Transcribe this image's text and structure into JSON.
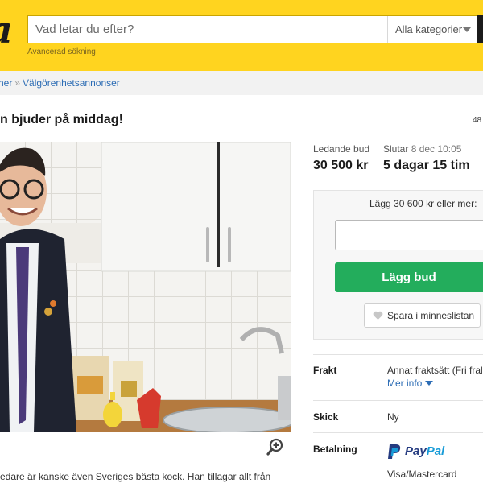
{
  "header": {
    "logo_text": "a",
    "search_placeholder": "Vad letar du efter?",
    "category_select": "Alla kategorier",
    "advanced_search": "Avancerad sökning"
  },
  "breadcrumb": {
    "items": [
      "ner",
      "Välgörenhetsannonser"
    ],
    "separator": "»"
  },
  "listing": {
    "title": "n bjuder på middag!",
    "count_partial": "48",
    "description_partial": "edare är kanske även Sveriges bästa kock. Han tillagar allt från"
  },
  "bid": {
    "leading_label": "Ledande bud",
    "leading_value": "30 500 kr",
    "ends_label": "Slutar",
    "ends_date": "8 dec 10:05",
    "time_left": "5 dagar 15 tim",
    "prompt": "Lägg 30 600 kr eller mer:",
    "input_value": "",
    "bid_button": "Lägg bud",
    "save_button": "Spara i minneslistan"
  },
  "details": {
    "shipping_label": "Frakt",
    "shipping_value": "Annat fraktsätt (Fri fral",
    "more_info": "Mer info",
    "condition_label": "Skick",
    "condition_value": "Ny",
    "payment_label": "Betalning",
    "payment_paypal_pay": "Pay",
    "payment_paypal_pal": "Pal",
    "payment_cards": "Visa/Mastercard"
  },
  "colors": {
    "header": "#ffd41f",
    "bid_button": "#23ad5c",
    "link": "#2d6db5",
    "paypal_dark": "#253b80",
    "paypal_light": "#179bd7"
  }
}
